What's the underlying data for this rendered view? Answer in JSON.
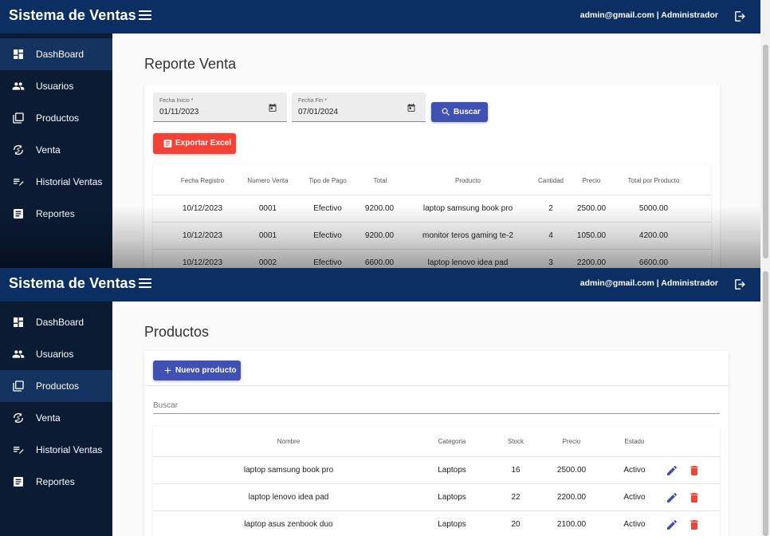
{
  "app": {
    "brand": "Sistema de Ventas",
    "user_text": "admin@gmail.com | Administrador"
  },
  "sidebar": {
    "items": [
      {
        "label": "DashBoard",
        "icon": "dashboard-icon"
      },
      {
        "label": "Usuarios",
        "icon": "users-icon"
      },
      {
        "label": "Productos",
        "icon": "library-icon"
      },
      {
        "label": "Venta",
        "icon": "currency-exchange-icon"
      },
      {
        "label": "Historial Ventas",
        "icon": "playlist-edit-icon"
      },
      {
        "label": "Reportes",
        "icon": "article-icon"
      }
    ]
  },
  "colors": {
    "topbar": "#0b2f62",
    "sidebar": "#0a1b33",
    "sidebar_active": "#14335f",
    "primary_button": "#3f51b5",
    "danger_button": "#f44336",
    "edit_icon": "#3f51b5",
    "delete_icon": "#f44336"
  },
  "reporte": {
    "title": "Reporte Venta",
    "fecha_inicio_label": "Fecha Inicio *",
    "fecha_inicio_value": "01/11/2023",
    "fecha_fin_label": "Fecha Fin *",
    "fecha_fin_value": "07/01/2024",
    "buscar_label": "Buscar",
    "exportar_label": "Exportar Excel",
    "columns": [
      "Fecha Registro",
      "Numero Venta",
      "Tipo de Pago",
      "Total",
      "Producto",
      "Cantidad",
      "Precio",
      "Total por Producto"
    ],
    "rows": [
      [
        "10/12/2023",
        "0001",
        "Efectivo",
        "9200.00",
        "laptop samsung book pro",
        "2",
        "2500.00",
        "5000.00"
      ],
      [
        "10/12/2023",
        "0001",
        "Efectivo",
        "9200.00",
        "monitor teros gaming te-2",
        "4",
        "1050.00",
        "4200.00"
      ],
      [
        "10/12/2023",
        "0002",
        "Efectivo",
        "6600.00",
        "laptop lenovo idea pad",
        "3",
        "2200.00",
        "6600.00"
      ]
    ]
  },
  "productos": {
    "title": "Productos",
    "nuevo_label": "Nuevo producto",
    "search_placeholder": "Buscar",
    "columns": [
      "Nombre",
      "Categoria",
      "Stock",
      "Precio",
      "Estado"
    ],
    "rows": [
      [
        "laptop samsung book pro",
        "Laptops",
        "16",
        "2500.00",
        "Activo"
      ],
      [
        "laptop lenovo idea pad",
        "Laptops",
        "22",
        "2200.00",
        "Activo"
      ],
      [
        "laptop asus zenbook duo",
        "Laptops",
        "20",
        "2100.00",
        "Activo"
      ]
    ]
  }
}
